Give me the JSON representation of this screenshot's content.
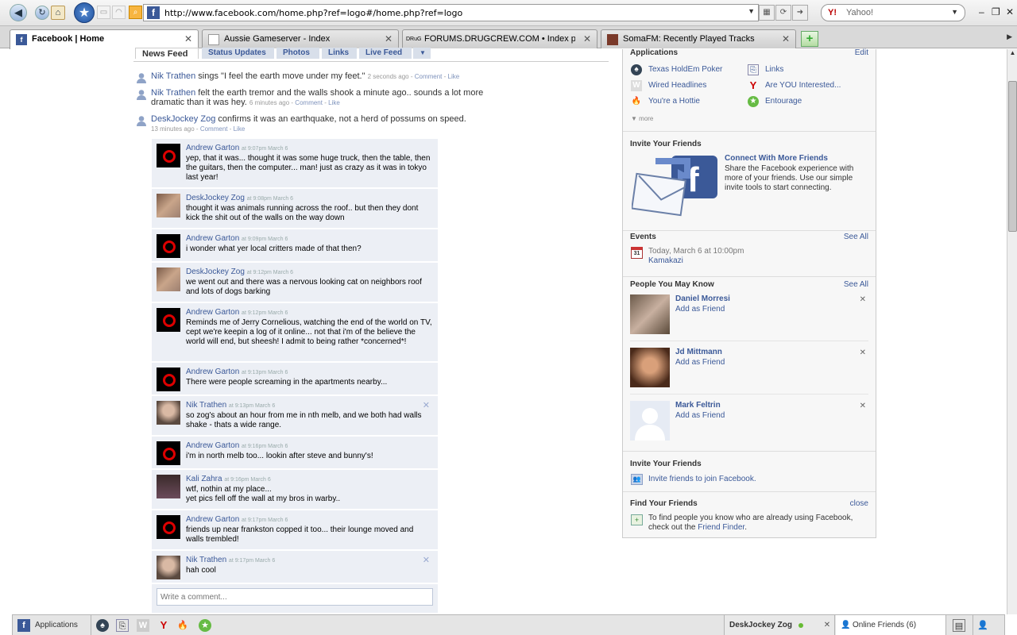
{
  "browser": {
    "url": "http://www.facebook.com/home.php?ref=logo#/home.php?ref=logo",
    "search_engine": "Yahoo!",
    "tabs": [
      {
        "label": "Facebook | Home",
        "active": true
      },
      {
        "label": "Aussie Gameserver - Index",
        "active": false
      },
      {
        "label": "FORUMS.DRUGCREW.COM • Index p...",
        "active": false
      },
      {
        "label": "SomaFM: Recently Played Tracks",
        "active": false
      }
    ]
  },
  "feed": {
    "tabs": [
      "News Feed",
      "Status Updates",
      "Photos",
      "Links",
      "Live Feed"
    ],
    "stories": [
      {
        "name": "Nik Trathen",
        "text": " sings \"I feel the earth move under my feet.\"",
        "time": "2 seconds ago",
        "comment": "Comment",
        "like": "Like"
      },
      {
        "name": "Nik Trathen",
        "text": " felt the earth tremor and the walls shook a minute ago.. sounds a lot more dramatic than it was hey.",
        "time": "6 minutes ago",
        "comment": "Comment",
        "like": "Like"
      },
      {
        "name": "DeskJockey Zog",
        "text": " confirms it was an earthquake, not a herd of possums on speed.",
        "time": "13 minutes ago",
        "comment": "Comment",
        "like": "Like"
      }
    ],
    "comments": [
      {
        "name": "Andrew Garton",
        "time": "at 9:07pm March 6",
        "text": "yep, that it was... thought it was some huge truck, then the table, then the guitars, then the computer... man! just as crazy as it was in tokyo last year!"
      },
      {
        "name": "DeskJockey Zog",
        "time": "at 9:08pm March 6",
        "text": "thought it was animals running across the roof.. but then they dont kick the shit out of the walls on the way down"
      },
      {
        "name": "Andrew Garton",
        "time": "at 9:09pm March 6",
        "text": "i wonder what yer local critters made of that then?"
      },
      {
        "name": "DeskJockey Zog",
        "time": "at 9:12pm March 6",
        "text": "we went out and there was a nervous looking cat on neighbors roof and lots of dogs barking"
      },
      {
        "name": "Andrew Garton",
        "time": "at 9:12pm March 6",
        "text": "Reminds me of Jerry Cornelious, watching the end of the world on TV, cept we're keepin a log of it online... not that i'm of the believe the world will end, but sheesh! I admit to being rather *concerned*!"
      },
      {
        "name": "Andrew Garton",
        "time": "at 9:13pm March 6",
        "text": "There were people screaming in the apartments nearby..."
      },
      {
        "name": "Nik Trathen",
        "time": "at 9:13pm March 6",
        "text": "so zog's about an hour from me in nth melb, and we both had walls shake - thats a wide range."
      },
      {
        "name": "Andrew Garton",
        "time": "at 9:16pm March 6",
        "text": "i'm in north melb too... lookin after steve and bunny's!"
      },
      {
        "name": "Kali Zahra",
        "time": "at 9:16pm March 6",
        "text": "wtf, nothin at my place...\nyet pics fell off the wall at my bros in warby.."
      },
      {
        "name": "Andrew Garton",
        "time": "at 9:17pm March 6",
        "text": "friends up near frankston copped it too... their lounge moved and walls trembled!"
      },
      {
        "name": "Nik Trathen",
        "time": "at 9:17pm March 6",
        "text": "hah cool"
      }
    ],
    "comment_placeholder": "Write a comment..."
  },
  "sidebar": {
    "applications": {
      "title": "Applications",
      "edit": "Edit",
      "items": [
        "Texas HoldEm Poker",
        "Links",
        "Wired Headlines",
        "Are YOU Interested...",
        "You're a Hottie",
        "Entourage"
      ],
      "more": "more"
    },
    "invite": {
      "title": "Invite Your Friends",
      "heading": "Connect With More Friends",
      "text": "Share the Facebook experience with more of your friends. Use our simple invite tools to start connecting."
    },
    "events": {
      "title": "Events",
      "see_all": "See All",
      "date_icon": "31",
      "when": "Today, March 6 at 10:00pm",
      "name": "Kamakazi"
    },
    "pymk": {
      "title": "People You May Know",
      "see_all": "See All",
      "add": "Add as Friend",
      "people": [
        "Daniel Morresi",
        "Jd Mittmann",
        "Mark Feltrin"
      ]
    },
    "invite2": {
      "title": "Invite Your Friends",
      "link": "Invite friends to join Facebook."
    },
    "find": {
      "title": "Find Your Friends",
      "close": "close",
      "text": "To find people you know who are already using Facebook, check out the ",
      "link": "Friend Finder",
      "end": "."
    }
  },
  "chatbar": {
    "applications": "Applications",
    "user": "DeskJockey Zog",
    "online": "Online Friends (6)"
  }
}
